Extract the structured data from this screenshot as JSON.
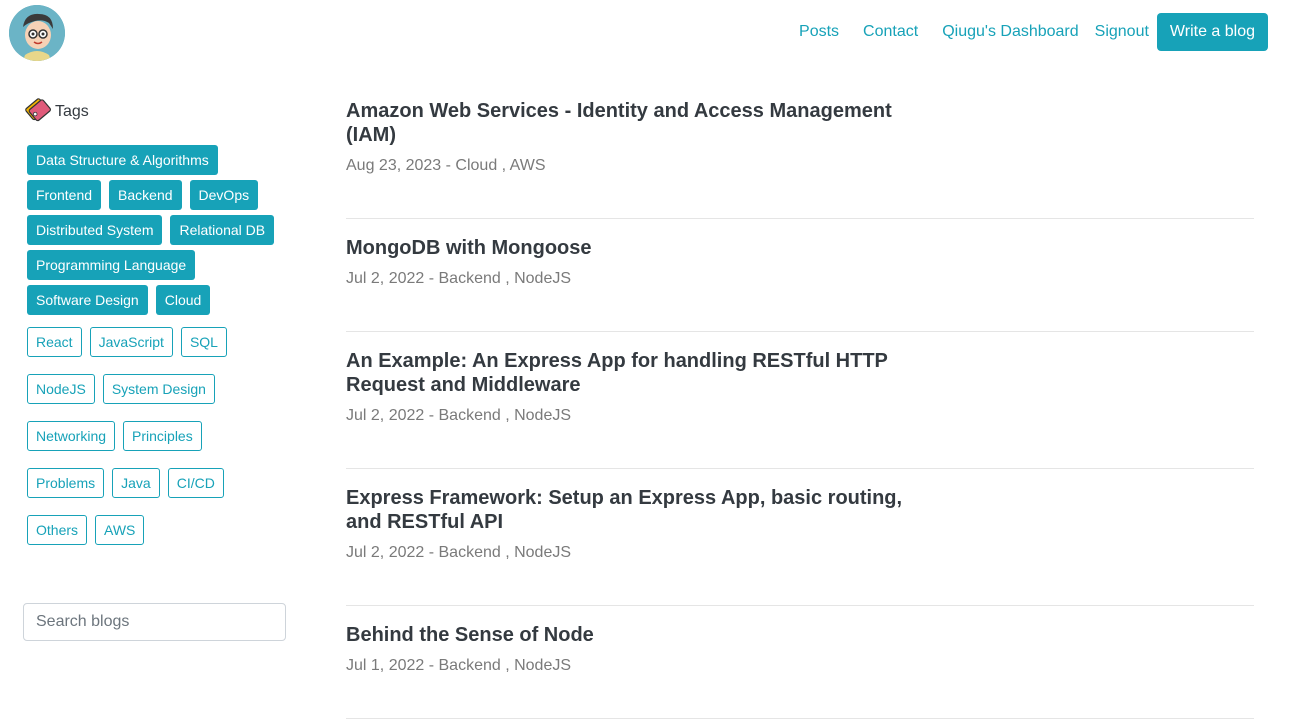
{
  "nav": {
    "links": [
      "Posts",
      "Contact",
      "Qiugu's Dashboard",
      "Signout"
    ],
    "write_button": "Write a blog"
  },
  "sidebar": {
    "tags_title": "Tags",
    "category_tags": [
      [
        "Data Structure & Algorithms"
      ],
      [
        "Frontend",
        "Backend",
        "DevOps"
      ],
      [
        "Distributed System",
        "Relational DB"
      ],
      [
        "Programming Language"
      ],
      [
        "Software Design",
        "Cloud"
      ]
    ],
    "topic_tags": [
      [
        "React",
        "JavaScript",
        "SQL"
      ],
      [
        "NodeJS",
        "System Design"
      ],
      [
        "Networking",
        "Principles"
      ],
      [
        "Problems",
        "Java",
        "CI/CD"
      ],
      [
        "Others",
        "AWS"
      ]
    ],
    "search_placeholder": "Search blogs"
  },
  "posts": [
    {
      "title": "Amazon Web Services - Identity and Access Management (IAM)",
      "meta": "Aug 23, 2023 - Cloud , AWS"
    },
    {
      "title": "MongoDB with Mongoose",
      "meta": "Jul 2, 2022 - Backend , NodeJS"
    },
    {
      "title": "An Example: An Express App for handling RESTful HTTP Request and Middleware",
      "meta": "Jul 2, 2022 - Backend , NodeJS"
    },
    {
      "title": "Express Framework: Setup an Express App, basic routing, and RESTful API",
      "meta": "Jul 2, 2022 - Backend , NodeJS"
    },
    {
      "title": "Behind the Sense of Node",
      "meta": "Jul 1, 2022 - Backend , NodeJS"
    }
  ]
}
